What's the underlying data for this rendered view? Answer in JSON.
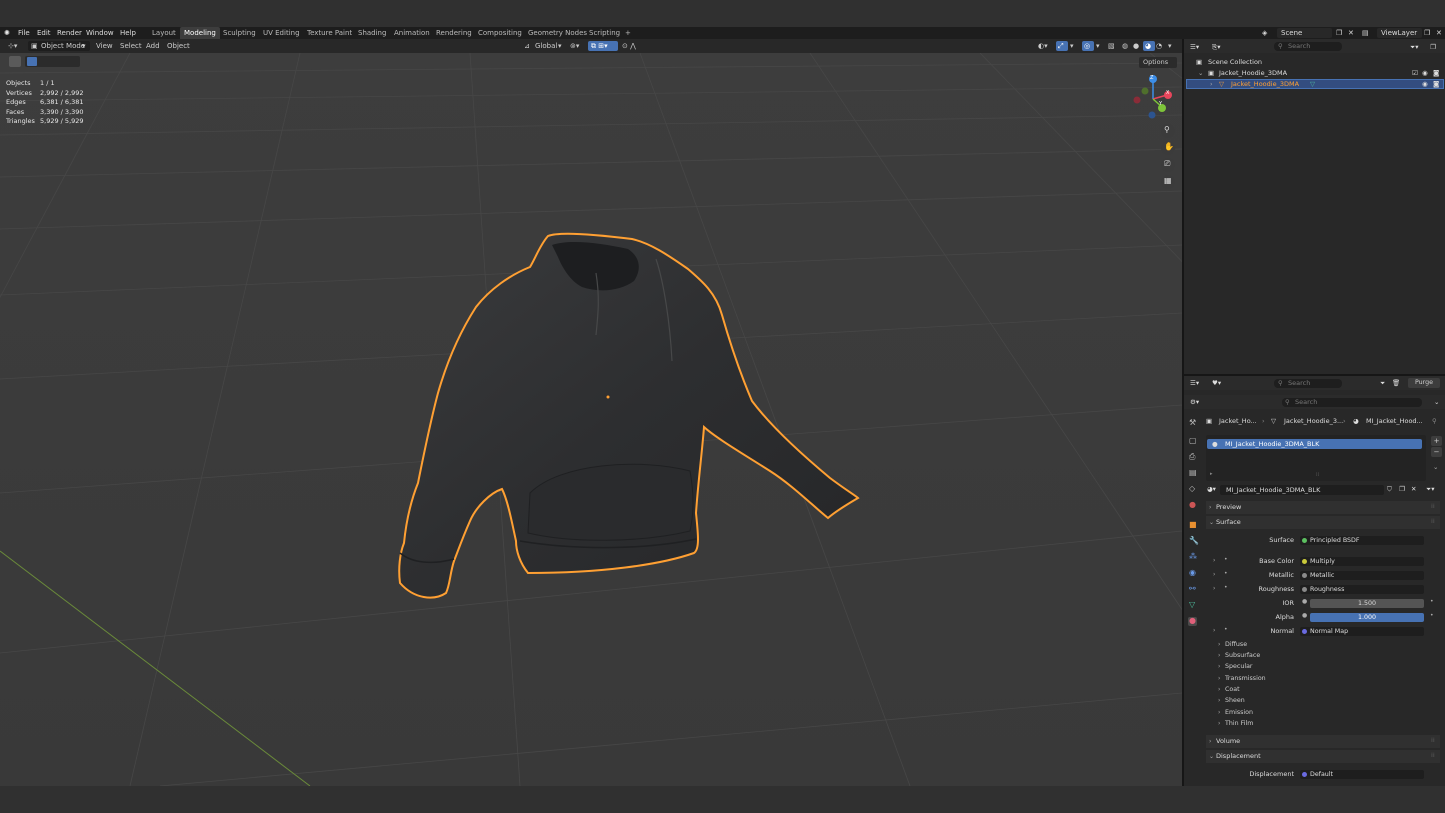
{
  "menu": [
    "File",
    "Edit",
    "Render",
    "Window",
    "Help"
  ],
  "workspaces": [
    "Layout",
    "Modeling",
    "Sculpting",
    "UV Editing",
    "Texture Paint",
    "Shading",
    "Animation",
    "Rendering",
    "Compositing",
    "Geometry Nodes",
    "Scripting"
  ],
  "active_workspace": "Modeling",
  "scene_label": "Scene",
  "viewlayer_label": "ViewLayer",
  "viewport_header": {
    "mode": "Object Mode",
    "view": "View",
    "select": "Select",
    "add": "Add",
    "object": "Object",
    "orientation": "Global",
    "options": "Options"
  },
  "stats": [
    {
      "label": "Objects",
      "value": "1 / 1"
    },
    {
      "label": "Vertices",
      "value": "2,992 / 2,992"
    },
    {
      "label": "Edges",
      "value": "6,381 / 6,381"
    },
    {
      "label": "Faces",
      "value": "3,390 / 3,390"
    },
    {
      "label": "Triangles",
      "value": "5,929 / 5,929"
    }
  ],
  "gizmo": {
    "z": "Z",
    "y": "Y",
    "x": "X"
  },
  "outliner": {
    "search_placeholder": "Search",
    "scene_collection": "Scene Collection",
    "collection": "Jacket_Hoodie_3DMA",
    "object": "Jacket_Hoodie_3DMA"
  },
  "properties": {
    "search_placeholder": "Search",
    "purge": "Purge",
    "search2_placeholder": "Search",
    "breadcrumb": [
      "Jacket_Ho...",
      "Jacket_Hoodie_3...",
      "MI_Jacket_Hood..."
    ],
    "material_slot": "MI_Jacket_Hoodie_3DMA_BLK",
    "material_name": "MI_Jacket_Hoodie_3DMA_BLK",
    "preview": "Preview",
    "surface_section": "Surface",
    "surface_label": "Surface",
    "surface_value": "Principled BSDF",
    "inputs": [
      {
        "label": "Base Color",
        "value": "Multiply",
        "color": "#c9c93a"
      },
      {
        "label": "Metallic",
        "value": "Metallic",
        "color": "#8a8a8a"
      },
      {
        "label": "Roughness",
        "value": "Roughness",
        "color": "#8a8a8a"
      }
    ],
    "ior_label": "IOR",
    "ior_value": "1.500",
    "alpha_label": "Alpha",
    "alpha_value": "1.000",
    "normal_label": "Normal",
    "normal_value": "Normal Map",
    "subpanels": [
      "Diffuse",
      "Subsurface",
      "Specular",
      "Transmission",
      "Coat",
      "Sheen",
      "Emission",
      "Thin Film"
    ],
    "volume": "Volume",
    "displacement_section": "Displacement",
    "displacement_label": "Displacement",
    "displacement_value": "Default"
  },
  "colors": {
    "accent_blue": "#4772b3",
    "selection_orange": "#ffa033",
    "x_axis": "#e8465c",
    "y_axis": "#7ec43a",
    "z_axis": "#3c8ee8"
  }
}
